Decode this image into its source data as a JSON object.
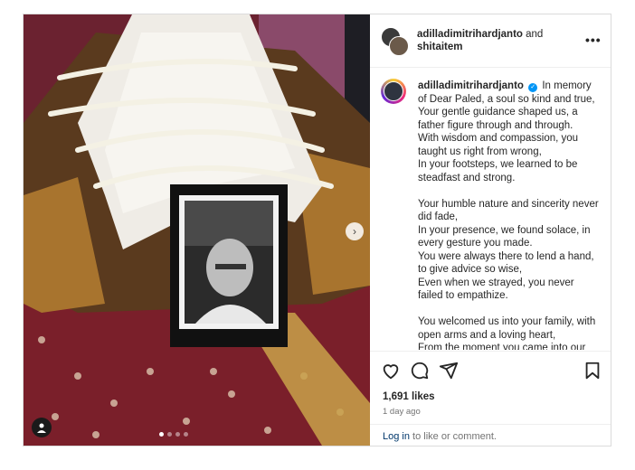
{
  "post": {
    "header": {
      "username_1": "adilladimitrihardjanto",
      "connector": " and",
      "username_2": "shitaitem",
      "more": "•••"
    },
    "caption": {
      "username": "adilladimitrihardjanto",
      "verified_mark": "✓",
      "text": " In memory of Dear Paled, a soul so kind and true,\nYour gentle guidance shaped us, a father figure through and through.\nWith wisdom and compassion, you taught us right from wrong,\nIn your footsteps, we learned to be steadfast and strong.\n\nYour humble nature and sincerity never did fade,\nIn your presence, we found solace, in every gesture you made.\nYou were always there to lend a hand, to give advice so wise,\nEven when we strayed, you never failed to empathize.\n\nYou welcomed us into your family, with open arms and a loving heart,\nFrom the moment you came into our"
    },
    "likes": "1,691 likes",
    "date": "1 day ago",
    "login": {
      "link": "Log in",
      "rest": " to like or comment."
    },
    "carousel": {
      "next": "›"
    },
    "icons": [
      "heart-icon",
      "comment-icon",
      "share-icon",
      "bookmark-icon",
      "user-icon",
      "chevron-right-icon"
    ]
  }
}
